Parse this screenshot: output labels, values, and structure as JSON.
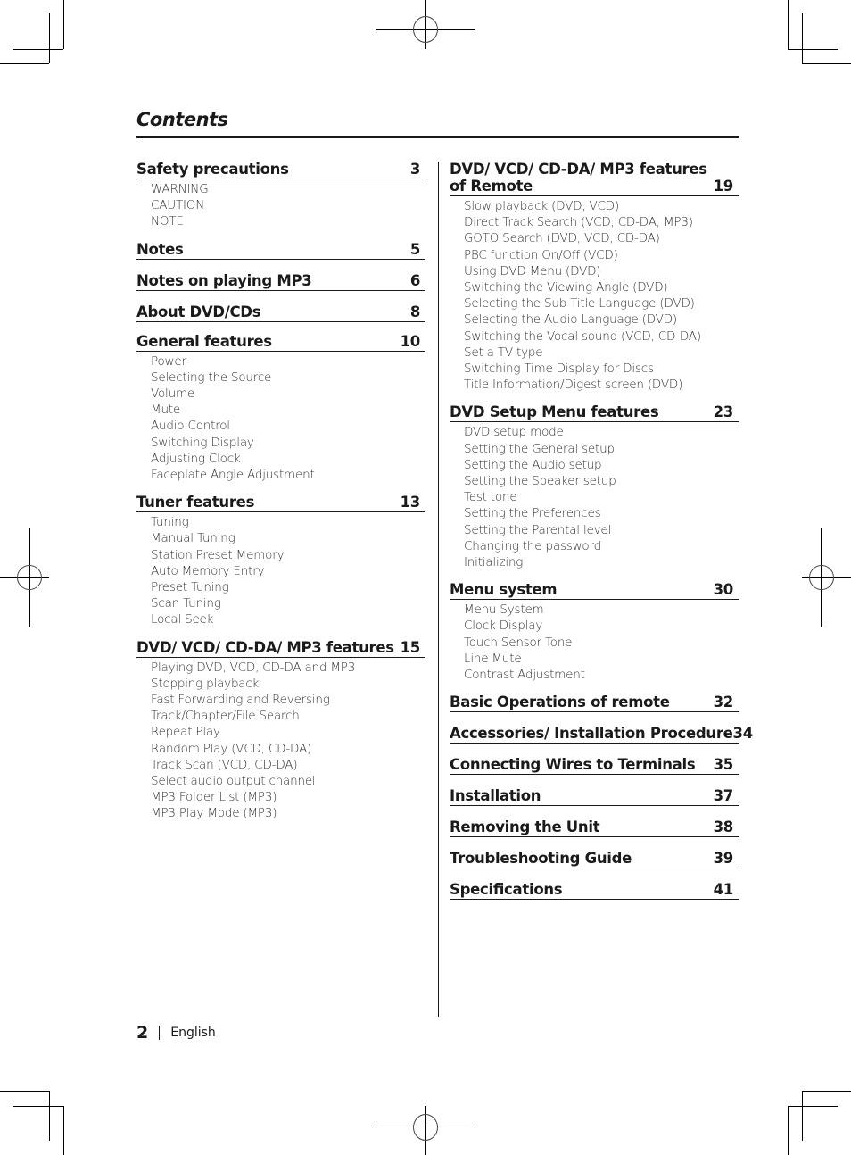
{
  "page": {
    "title": "Contents",
    "footer": {
      "page_number": "2",
      "language": "English"
    }
  },
  "left_column": [
    {
      "title": "Safety precautions",
      "page": "3",
      "items": [
        "WARNING",
        "CAUTION",
        "NOTE"
      ]
    },
    {
      "title": "Notes",
      "page": "5",
      "items": []
    },
    {
      "title": "Notes on playing MP3",
      "page": "6",
      "items": []
    },
    {
      "title": "About DVD/CDs",
      "page": "8",
      "items": []
    },
    {
      "title": "General features",
      "page": "10",
      "items": [
        "Power",
        "Selecting the Source",
        "Volume",
        "Mute",
        "Audio Control",
        "Switching Display",
        "Adjusting Clock",
        "Faceplate Angle Adjustment"
      ]
    },
    {
      "title": "Tuner features",
      "page": "13",
      "items": [
        "Tuning",
        "Manual Tuning",
        "Station Preset Memory",
        "Auto Memory Entry",
        "Preset Tuning",
        "Scan Tuning",
        "Local Seek"
      ]
    },
    {
      "title": "DVD/ VCD/ CD-DA/ MP3 features",
      "page": "15",
      "items": [
        "Playing DVD, VCD, CD-DA and MP3",
        "Stopping playback",
        "Fast Forwarding and Reversing",
        "Track/Chapter/File Search",
        "Repeat Play",
        "Random Play (VCD, CD-DA)",
        "Track Scan (VCD, CD-DA)",
        "Select audio output channel",
        "MP3 Folder List (MP3)",
        "MP3 Play Mode (MP3)"
      ]
    }
  ],
  "right_column": [
    {
      "title": "DVD/ VCD/ CD-DA/ MP3 features of Remote",
      "page": "19",
      "items": [
        "Slow playback (DVD, VCD)",
        "Direct Track Search (VCD, CD-DA, MP3)",
        "GOTO Search (DVD, VCD, CD-DA)",
        "PBC function On/Off (VCD)",
        "Using DVD Menu (DVD)",
        "Switching the Viewing Angle (DVD)",
        "Selecting the Sub Title Language (DVD)",
        "Selecting the Audio Language (DVD)",
        "Switching the Vocal sound (VCD, CD-DA)",
        "Set a TV type",
        "Switching Time Display  for Discs",
        "Title Information/Digest screen (DVD)"
      ]
    },
    {
      "title": "DVD Setup Menu features",
      "page": "23",
      "items": [
        "DVD setup mode",
        "Setting the General setup",
        "Setting the Audio setup",
        "Setting the Speaker setup",
        "Test tone",
        "Setting the Preferences",
        "Setting the Parental level",
        "Changing the password",
        "Initializing"
      ]
    },
    {
      "title": "Menu system",
      "page": "30",
      "items": [
        "Menu System",
        "Clock Display",
        "Touch Sensor Tone",
        "Line Mute",
        "Contrast Adjustment"
      ]
    },
    {
      "title": "Basic Operations of remote",
      "page": "32",
      "items": []
    },
    {
      "title": "Accessories/ Installation Procedure",
      "page": "34",
      "items": []
    },
    {
      "title": "Connecting Wires to Terminals",
      "page": "35",
      "items": []
    },
    {
      "title": "Installation",
      "page": "37",
      "items": []
    },
    {
      "title": "Removing the Unit",
      "page": "38",
      "items": []
    },
    {
      "title": "Troubleshooting Guide",
      "page": "39",
      "items": []
    },
    {
      "title": "Specifications",
      "page": "41",
      "items": []
    }
  ]
}
